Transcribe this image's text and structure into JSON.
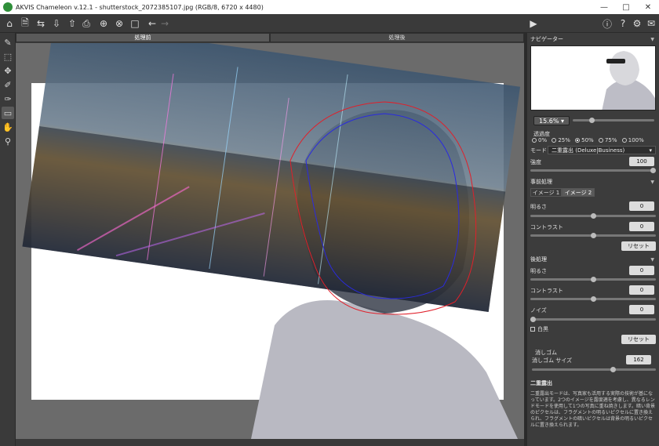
{
  "window": {
    "title": "AKVIS Chameleon v.12.1 - shutterstock_2072385107.jpg (RGB/8, 6720 x 4480)"
  },
  "tabs": [
    {
      "label": "処理前"
    },
    {
      "label": "処理後"
    }
  ],
  "navigator": {
    "title": "ナビゲーター"
  },
  "zoom": {
    "value": "15.6%",
    "level": 0.22
  },
  "opacity": {
    "label": "透過度",
    "options": [
      "0%",
      "25%",
      "50%",
      "75%",
      "100%"
    ],
    "selected": "50%"
  },
  "mode": {
    "label": "モード",
    "value": "二重露出 (Deluxe|Business)"
  },
  "strength": {
    "label": "強度",
    "value": "100",
    "level": 1.0
  },
  "preprocess": {
    "title": "事前処理",
    "subtabs": [
      "イメージ 1",
      "イメージ 2"
    ],
    "active_subtab": "イメージ 2",
    "brightness": {
      "label": "明るさ",
      "value": "0",
      "level": 0.5
    },
    "contrast": {
      "label": "コントラスト",
      "value": "0",
      "level": 0.5
    },
    "reset_label": "リセット"
  },
  "postprocess": {
    "title": "後処理",
    "brightness": {
      "label": "明るさ",
      "value": "0",
      "level": 0.5
    },
    "contrast": {
      "label": "コントラスト",
      "value": "0",
      "level": 0.5
    },
    "noise": {
      "label": "ノイズ",
      "value": "0",
      "level": 0.0
    },
    "bw_label": "白黒",
    "reset_label": "リセット"
  },
  "eraser": {
    "title": "消しゴム",
    "size_label": "消しゴム サイズ",
    "size_value": "162",
    "level": 0.66
  },
  "help": {
    "title": "二重露出",
    "text": "二重露出モードは、写真家も活用する実際の技術が基になっています。2つのイメージを露度適を考慮し、異なるレンドモードを使用して1つの写真に重ね焼きします。暗い背景のピクセルは、フラグメントの明るいピクセルに置き換えられ、フラグメントの暗いピクセルは背景の明るいピクセルに置き換えられます。"
  },
  "colors": {
    "accent": "#2f8f3a",
    "selection_red": "#e0202a",
    "selection_blue": "#2a2ae0"
  }
}
